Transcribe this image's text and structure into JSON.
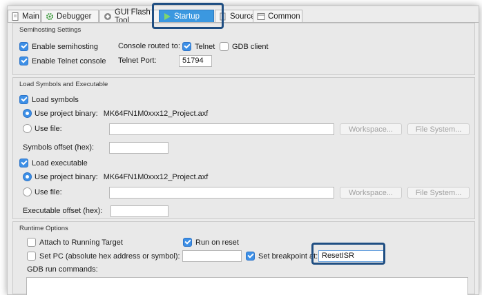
{
  "tabs": [
    {
      "label": "Main",
      "icon": "document-icon"
    },
    {
      "label": "Debugger",
      "icon": "gear-icon"
    },
    {
      "label": "GUI Flash Tool",
      "icon": "flash-tool-icon"
    },
    {
      "label": "Startup",
      "icon": "play-icon"
    },
    {
      "label": "Source",
      "icon": "source-icon"
    },
    {
      "label": "Common",
      "icon": "common-icon"
    }
  ],
  "semihosting": {
    "title": "Semihosting Settings",
    "enable_semihosting": {
      "label": "Enable semihosting",
      "checked": true
    },
    "console_routed_label": "Console routed to:",
    "telnet": {
      "label": "Telnet",
      "checked": true
    },
    "gdb_client": {
      "label": "GDB client",
      "checked": false
    },
    "enable_telnet_console": {
      "label": "Enable Telnet console",
      "checked": true
    },
    "telnet_port_label": "Telnet Port:",
    "telnet_port_value": "51794"
  },
  "load": {
    "title": "Load Symbols and Executable",
    "load_symbols": {
      "label": "Load symbols",
      "checked": true
    },
    "sym_use_project": {
      "label": "Use project binary:",
      "value": "MK64FN1M0xxx12_Project.axf",
      "selected": true
    },
    "sym_use_file": {
      "label": "Use file:",
      "value": "",
      "selected": false
    },
    "workspace_label": "Workspace...",
    "file_system_label": "File System...",
    "symbols_offset_label": "Symbols offset (hex):",
    "symbols_offset_value": "",
    "load_executable": {
      "label": "Load executable",
      "checked": true
    },
    "exe_use_project": {
      "label": "Use project binary:",
      "value": "MK64FN1M0xxx12_Project.axf",
      "selected": true
    },
    "exe_use_file": {
      "label": "Use file:",
      "value": "",
      "selected": false
    },
    "executable_offset_label": "Executable offset (hex):",
    "executable_offset_value": ""
  },
  "runtime": {
    "title": "Runtime Options",
    "attach_running": {
      "label": "Attach to Running Target",
      "checked": false
    },
    "run_on_reset": {
      "label": "Run on reset",
      "checked": true
    },
    "set_pc": {
      "label": "Set PC (absolute hex address or symbol):",
      "checked": false
    },
    "set_pc_value": "",
    "set_breakpoint": {
      "label": "Set breakpoint at:",
      "checked": true
    },
    "breakpoint_value": "ResetISR",
    "gdb_run_commands_label": "GDB run commands:",
    "gdb_run_commands_value": ""
  },
  "colors": {
    "active_tab": "#3b98e0",
    "checkbox_blue": "#3d8fe6",
    "highlight_box": "#1f4e82"
  }
}
